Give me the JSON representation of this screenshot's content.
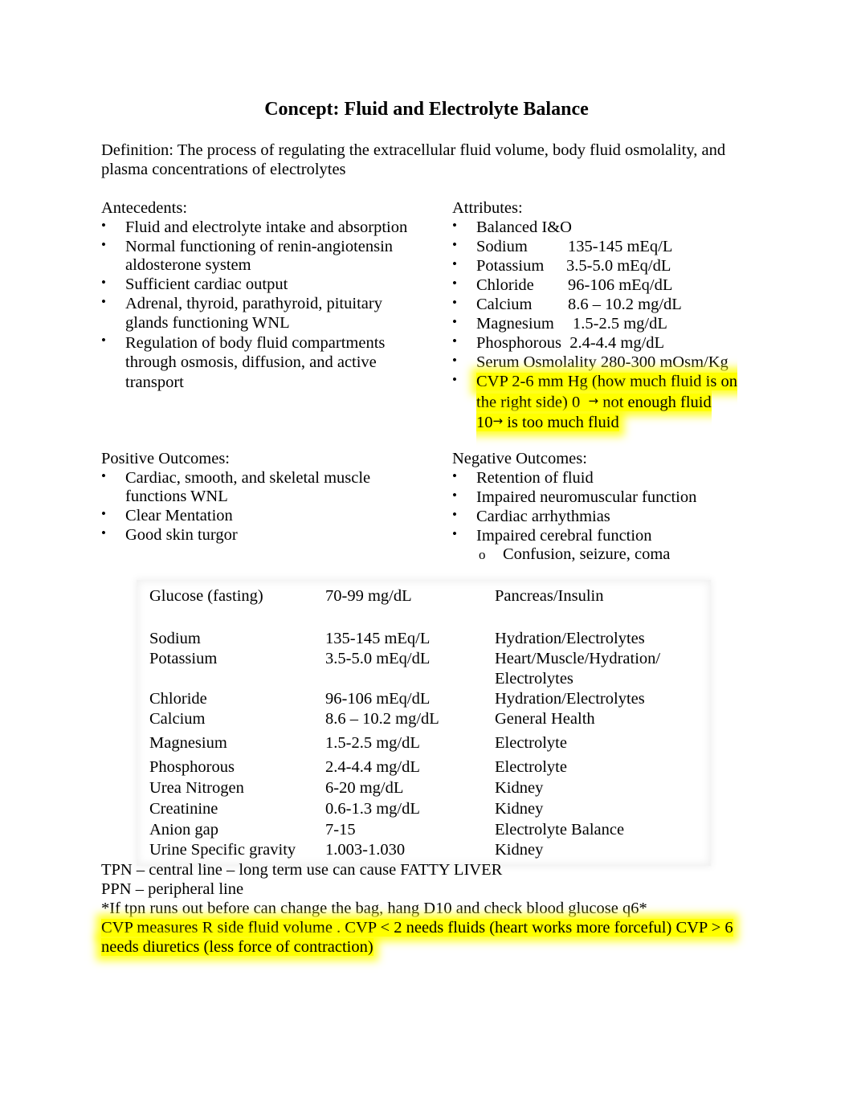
{
  "title": "Concept: Fluid and Electrolyte Balance",
  "definition": "Definition: The process of regulating the extracellular fluid volume, body fluid osmolality, and plasma concentrations of electrolytes",
  "antecedents": {
    "heading": "Antecedents:",
    "items": [
      "Fluid and electrolyte intake and absorption",
      "Normal functioning of renin-angiotensin aldosterone system",
      "Sufficient cardiac output",
      "Adrenal, thyroid, parathyroid, pituitary glands functioning WNL",
      "Regulation of body fluid compartments through osmosis, diffusion, and active transport"
    ]
  },
  "attributes": {
    "heading": "Attributes:",
    "items": [
      {
        "name": "Balanced I&O",
        "value": ""
      },
      {
        "name": "Sodium",
        "value": "135-145 mEq/L"
      },
      {
        "name": "Potassium",
        "value": "3.5-5.0 mEq/dL"
      },
      {
        "name": "Chloride",
        "value": "96-106 mEq/dL"
      },
      {
        "name": "Calcium",
        "value": "8.6 – 10.2 mg/dL"
      },
      {
        "name": "Magnesium",
        "value": "1.5-2.5 mg/dL"
      },
      {
        "name": "Phosphorous",
        "value": "2.4-4.4 mg/dL"
      },
      {
        "name": "Serum Osmolality",
        "value": "280-300 mOsm/Kg"
      }
    ],
    "cvp": {
      "line1": "CVP 2-6 mm Hg (how much fluid is on",
      "line2_a": "the right side) 0",
      "line2_b": "not enough fluid",
      "line3_a": "10",
      "line3_b": "is too much fluid",
      "arrow": "→"
    }
  },
  "positive_outcomes": {
    "heading": "Positive Outcomes:",
    "items": [
      "Cardiac, smooth, and skeletal muscle functions WNL",
      "Clear Mentation",
      "Good skin turgor"
    ]
  },
  "negative_outcomes": {
    "heading": "Negative Outcomes:",
    "items": [
      "Retention of fluid",
      "Impaired neuromuscular function",
      "Cardiac arrhythmias",
      "Impaired cerebral function"
    ],
    "sub_items": [
      "Confusion, seizure, coma"
    ]
  },
  "lab_table": {
    "rows": [
      [
        "Glucose (fasting)",
        "70-99 mg/dL",
        "Pancreas/Insulin"
      ],
      [
        "Sodium",
        "135-145 mEq/L",
        "Hydration/Electrolytes"
      ],
      [
        "Potassium",
        "3.5-5.0 mEq/dL",
        "Heart/Muscle/Hydration/ Electrolytes"
      ],
      [
        "Chloride",
        "96-106 mEq/dL",
        "Hydration/Electrolytes"
      ],
      [
        "Calcium",
        "8.6 – 10.2 mg/dL",
        "General Health"
      ],
      [
        "Magnesium",
        "1.5-2.5 mg/dL",
        "Electrolyte"
      ],
      [
        "Phosphorous",
        "2.4-4.4 mg/dL",
        "Electrolyte"
      ],
      [
        "Urea Nitrogen",
        "6-20 mg/dL",
        "Kidney"
      ],
      [
        "Creatinine",
        "0.6-1.3 mg/dL",
        "Kidney"
      ],
      [
        "Anion gap",
        "7-15",
        "Electrolyte Balance"
      ],
      [
        "Urine Specific gravity",
        "1.003-1.030",
        "Kidney"
      ]
    ]
  },
  "notes": {
    "tpn": "TPN – central line – long term use can cause FATTY LIVER",
    "ppn": "PPN – peripheral line",
    "tpn_tip": "*If tpn runs out before can change the bag, hang D10 and check blood glucose q6*",
    "cvp_line1": "CVP  measures R side fluid volume . CVP < 2 needs fluids (heart works more forceful)  CVP > 6",
    "cvp_line2": "needs diuretics (less force of contraction)"
  },
  "highlight_color": "#ffff00",
  "bullet_glyph": "•",
  "sub_bullet_glyph": "o"
}
